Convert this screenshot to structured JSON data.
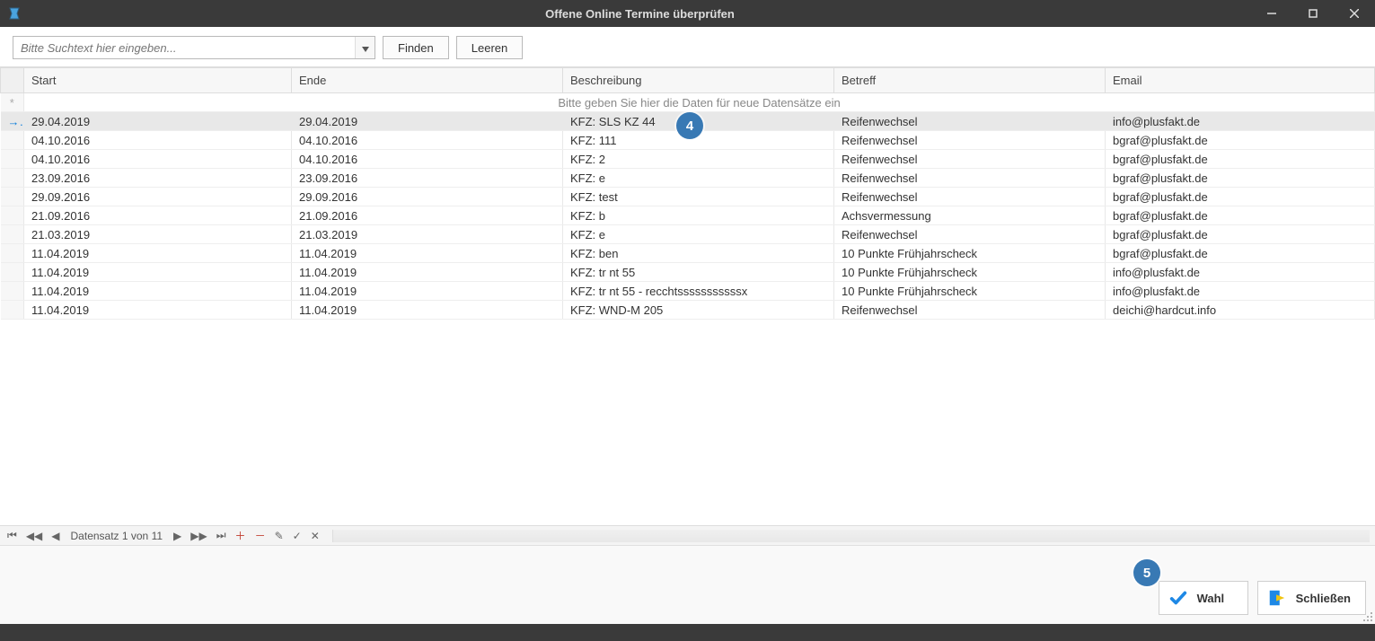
{
  "window": {
    "title": "Offene Online Termine überprüfen"
  },
  "toolbar": {
    "search_placeholder": "Bitte Suchtext hier eingeben...",
    "find_label": "Finden",
    "clear_label": "Leeren"
  },
  "grid": {
    "columns": [
      "Start",
      "Ende",
      "Beschreibung",
      "Betreff",
      "Email"
    ],
    "new_row_hint": "Bitte geben Sie hier die Daten  für neue Datensätze ein",
    "rows": [
      {
        "start": "29.04.2019",
        "ende": "29.04.2019",
        "beschreibung": "KFZ: SLS KZ 44",
        "betreff": "Reifenwechsel",
        "email": "info@plusfakt.de"
      },
      {
        "start": "04.10.2016",
        "ende": "04.10.2016",
        "beschreibung": "KFZ: 111",
        "betreff": "Reifenwechsel",
        "email": "bgraf@plusfakt.de"
      },
      {
        "start": "04.10.2016",
        "ende": "04.10.2016",
        "beschreibung": "KFZ: 2",
        "betreff": "Reifenwechsel",
        "email": "bgraf@plusfakt.de"
      },
      {
        "start": "23.09.2016",
        "ende": "23.09.2016",
        "beschreibung": "KFZ: e",
        "betreff": "Reifenwechsel",
        "email": "bgraf@plusfakt.de"
      },
      {
        "start": "29.09.2016",
        "ende": "29.09.2016",
        "beschreibung": "KFZ: test",
        "betreff": "Reifenwechsel",
        "email": "bgraf@plusfakt.de"
      },
      {
        "start": "21.09.2016",
        "ende": "21.09.2016",
        "beschreibung": "KFZ: b",
        "betreff": "Achsvermessung",
        "email": "bgraf@plusfakt.de"
      },
      {
        "start": "21.03.2019",
        "ende": "21.03.2019",
        "beschreibung": "KFZ: e",
        "betreff": "Reifenwechsel",
        "email": "bgraf@plusfakt.de"
      },
      {
        "start": "11.04.2019",
        "ende": "11.04.2019",
        "beschreibung": "KFZ: ben",
        "betreff": "10 Punkte Frühjahrscheck",
        "email": "bgraf@plusfakt.de"
      },
      {
        "start": "11.04.2019",
        "ende": "11.04.2019",
        "beschreibung": "KFZ: tr nt 55",
        "betreff": "10 Punkte Frühjahrscheck",
        "email": "info@plusfakt.de"
      },
      {
        "start": "11.04.2019",
        "ende": "11.04.2019",
        "beschreibung": "KFZ: tr nt 55 - recchtsssssssssssx",
        "betreff": "10 Punkte Frühjahrscheck",
        "email": "info@plusfakt.de"
      },
      {
        "start": "11.04.2019",
        "ende": "11.04.2019",
        "beschreibung": "KFZ: WND-M 205",
        "betreff": "Reifenwechsel",
        "email": "deichi@hardcut.info"
      }
    ]
  },
  "navigator": {
    "status": "Datensatz 1 von 11"
  },
  "footer": {
    "select_label": "Wahl",
    "close_label": "Schließen"
  },
  "callouts": {
    "c4": "4",
    "c5": "5"
  }
}
